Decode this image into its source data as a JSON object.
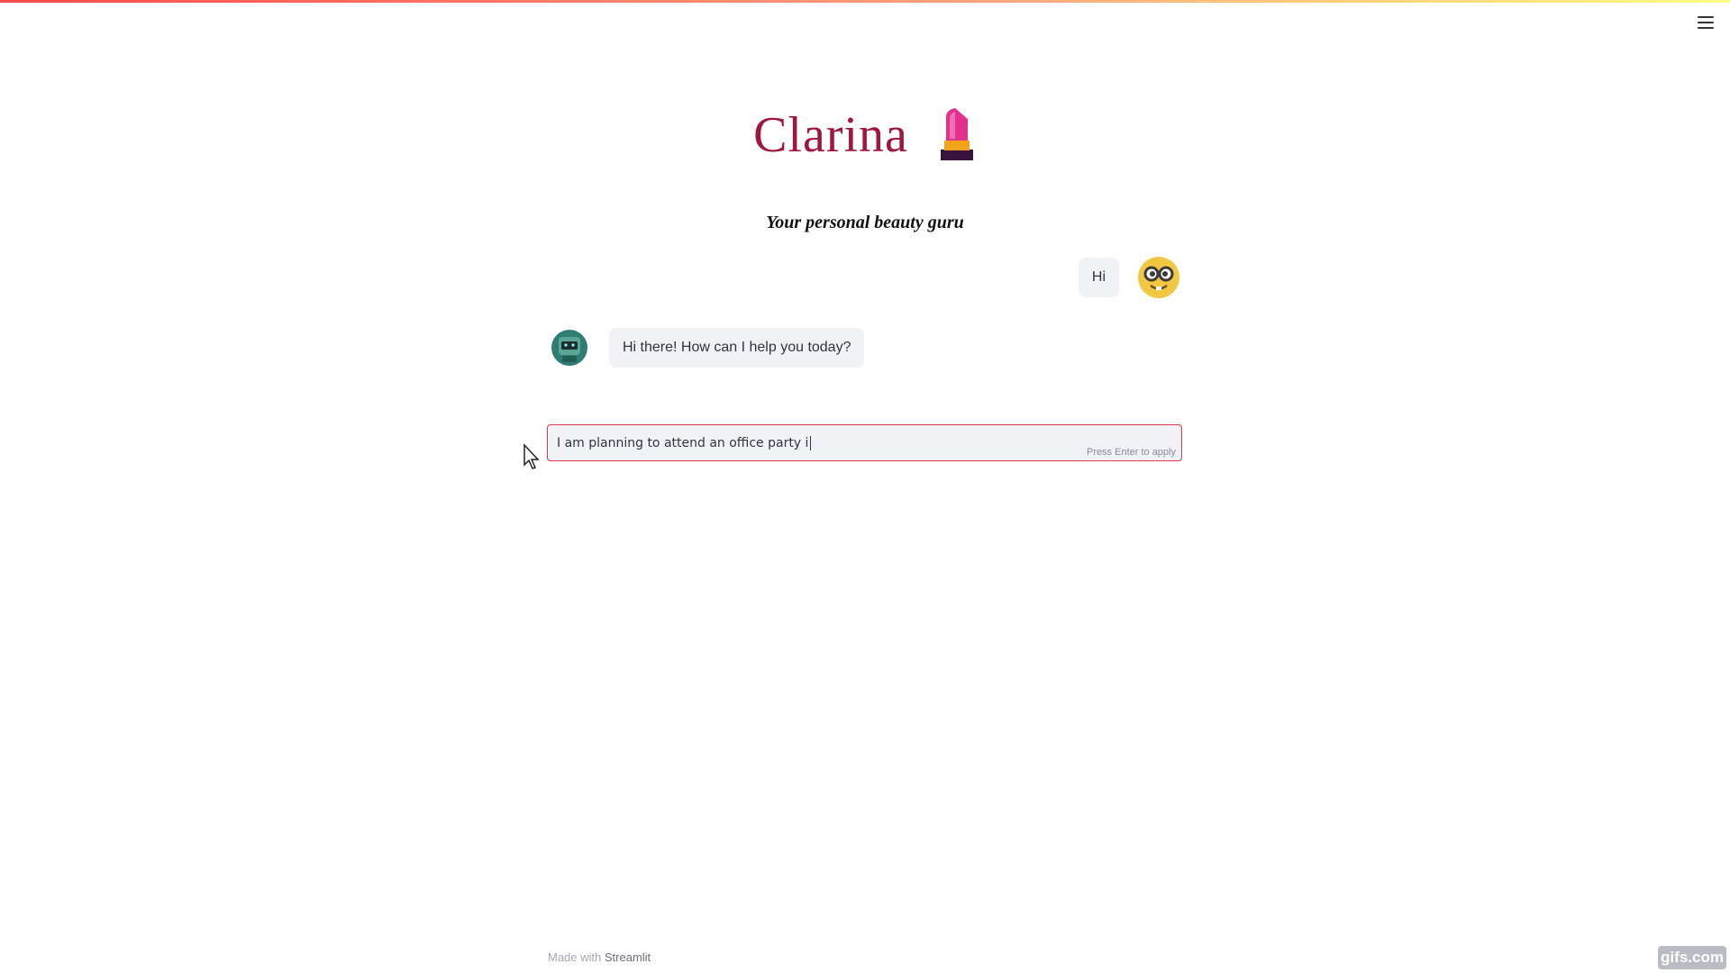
{
  "app": {
    "title": "Clarina",
    "subtitle": "Your personal beauty guru",
    "menu_icon": "hamburger-icon"
  },
  "chat": {
    "messages": [
      {
        "role": "user",
        "text": "Hi",
        "avatar": "nerd-face-icon"
      },
      {
        "role": "assistant",
        "text": "Hi there! How can I help you today?",
        "avatar": "robot-icon"
      }
    ]
  },
  "input": {
    "value": "I am planning to attend an office party i",
    "hint": "Press Enter to apply"
  },
  "footer": {
    "made_with": "Made with",
    "brand": "Streamlit"
  },
  "watermark": "gifs.com",
  "colors": {
    "accent": "#ff4b4b",
    "title": "#a0163f",
    "bubble_bg": "#f0f2f6",
    "input_border": "#e0384b"
  }
}
